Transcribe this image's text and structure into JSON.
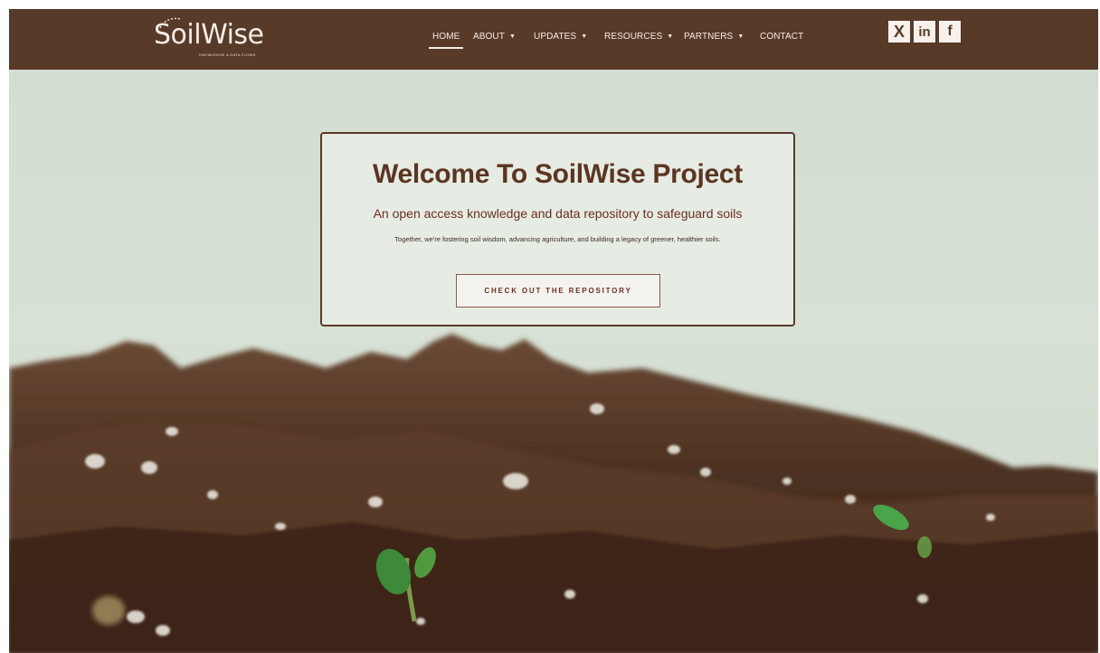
{
  "header": {
    "logo": {
      "name": "SoilWise",
      "tagline": "KNOWLEDGE & DATA FLOWS"
    },
    "nav": [
      {
        "label": "HOME",
        "active": true,
        "dropdown": false
      },
      {
        "label": "ABOUT",
        "active": false,
        "dropdown": true
      },
      {
        "label": "UPDATES",
        "active": false,
        "dropdown": true
      },
      {
        "label": "RESOURCES",
        "active": false,
        "dropdown": true
      },
      {
        "label": "PARTNERS",
        "active": false,
        "dropdown": true
      },
      {
        "label": "CONTACT",
        "active": false,
        "dropdown": false
      }
    ],
    "social": [
      {
        "icon": "x-icon",
        "glyph": "X"
      },
      {
        "icon": "linkedin-icon",
        "glyph": "in"
      },
      {
        "icon": "facebook-icon",
        "glyph": "f"
      }
    ]
  },
  "hero": {
    "title": "Welcome To SoilWise Project",
    "subtitle": "An open access knowledge and data repository to safeguard soils",
    "description": "Together, we're fostering soil wisdom, advancing agriculture, and building a legacy of greener, healthier soils.",
    "cta_label": "CHECK OUT THE REPOSITORY"
  },
  "colors": {
    "header_bg": "#583a28",
    "hero_bg": "#d5dfd3",
    "title": "#5b3522",
    "accent": "#6a2f22"
  }
}
